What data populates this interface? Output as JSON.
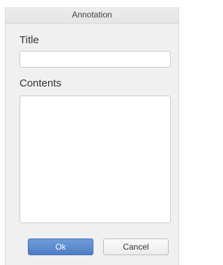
{
  "dialog": {
    "title": "Annotation"
  },
  "fields": {
    "title_label": "Title",
    "title_value": "",
    "contents_label": "Contents",
    "contents_value": ""
  },
  "buttons": {
    "ok_label": "Ok",
    "cancel_label": "Cancel"
  },
  "colors": {
    "ok_button": "#5b89cc",
    "dialog_background": "#f0f0f0"
  }
}
